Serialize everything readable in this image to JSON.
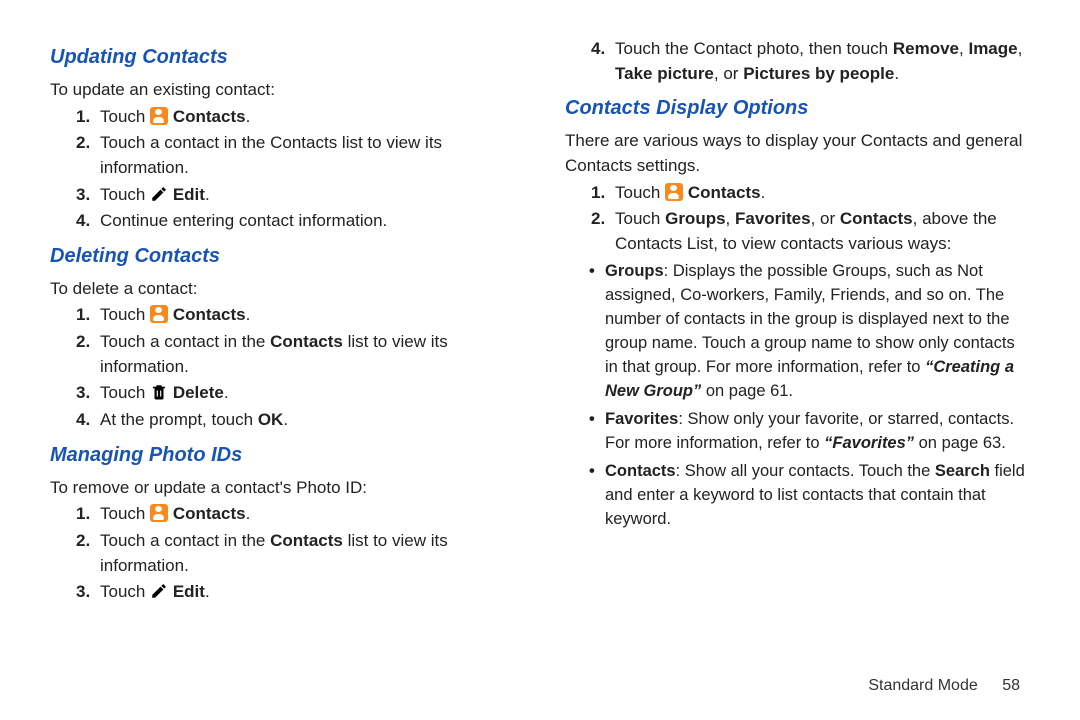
{
  "left": {
    "updating": {
      "heading": "Updating Contacts",
      "intro": "To update an existing contact:",
      "steps": [
        {
          "pre": "Touch ",
          "icon": "contacts",
          "boldAfter": "Contacts",
          "post": "."
        },
        {
          "pre": "Touch a contact in the Contacts list to view its information."
        },
        {
          "pre": "Touch ",
          "icon": "edit",
          "boldAfter": "Edit",
          "post": "."
        },
        {
          "pre": "Continue entering contact information."
        }
      ]
    },
    "deleting": {
      "heading": "Deleting Contacts",
      "intro": "To delete a contact:",
      "steps": [
        {
          "pre": "Touch ",
          "icon": "contacts",
          "boldAfter": "Contacts",
          "post": "."
        },
        {
          "preMixed": [
            "Touch a contact in the ",
            {
              "b": "Contacts"
            },
            " list to view its information."
          ]
        },
        {
          "pre": "Touch  ",
          "icon": "delete",
          "boldAfter": "Delete",
          "post": "."
        },
        {
          "preMixed": [
            "At the prompt, touch ",
            {
              "b": "OK"
            },
            "."
          ]
        }
      ]
    },
    "photo": {
      "heading": "Managing Photo IDs",
      "intro": "To remove or update a contact's Photo ID:",
      "steps": [
        {
          "pre": "Touch ",
          "icon": "contacts",
          "boldAfter": "Contacts",
          "post": "."
        },
        {
          "preMixed": [
            "Touch a contact in the ",
            {
              "b": "Contacts"
            },
            " list to view its information."
          ]
        },
        {
          "pre": "Touch ",
          "icon": "edit",
          "boldAfter": "Edit",
          "post": "."
        }
      ]
    }
  },
  "right": {
    "continue_steps": [
      {
        "num": "4.",
        "mixed": [
          "Touch the Contact photo, then touch ",
          {
            "b": "Remove"
          },
          ", ",
          {
            "b": "Image"
          },
          ", ",
          {
            "b": "Take picture"
          },
          ", or ",
          {
            "b": "Pictures by people"
          },
          "."
        ]
      }
    ],
    "display": {
      "heading": "Contacts Display Options",
      "intro": "There are various ways to display your Contacts and general Contacts settings.",
      "steps": [
        {
          "pre": "Touch ",
          "icon": "contacts",
          "boldAfter": "Contacts",
          "post": "."
        },
        {
          "preMixed": [
            "Touch ",
            {
              "b": "Groups"
            },
            ", ",
            {
              "b": "Favorites"
            },
            ", or ",
            {
              "b": "Contacts"
            },
            ", above the Contacts List, to view contacts various ways:"
          ]
        }
      ],
      "bullets": [
        {
          "mixed": [
            {
              "b": "Groups"
            },
            ": Displays the possible Groups, such as Not assigned, Co-workers, Family, Friends, and so on. The number of contacts in the group is displayed next to the group name. Touch a group name to show only contacts in that group. For more information, refer to ",
            {
              "bi": "“Creating a New Group”"
            },
            " on page 61."
          ]
        },
        {
          "mixed": [
            {
              "b": "Favorites"
            },
            ": Show only your favorite, or starred, contacts. For more information, refer to ",
            {
              "bi": "“Favorites”"
            },
            " on page 63."
          ]
        },
        {
          "mixed": [
            {
              "b": "Contacts"
            },
            ": Show all your contacts. Touch the ",
            {
              "b": "Search"
            },
            " field and enter a keyword to list contacts that contain that keyword."
          ]
        }
      ]
    }
  },
  "footer": {
    "section": "Standard Mode",
    "page": "58"
  }
}
